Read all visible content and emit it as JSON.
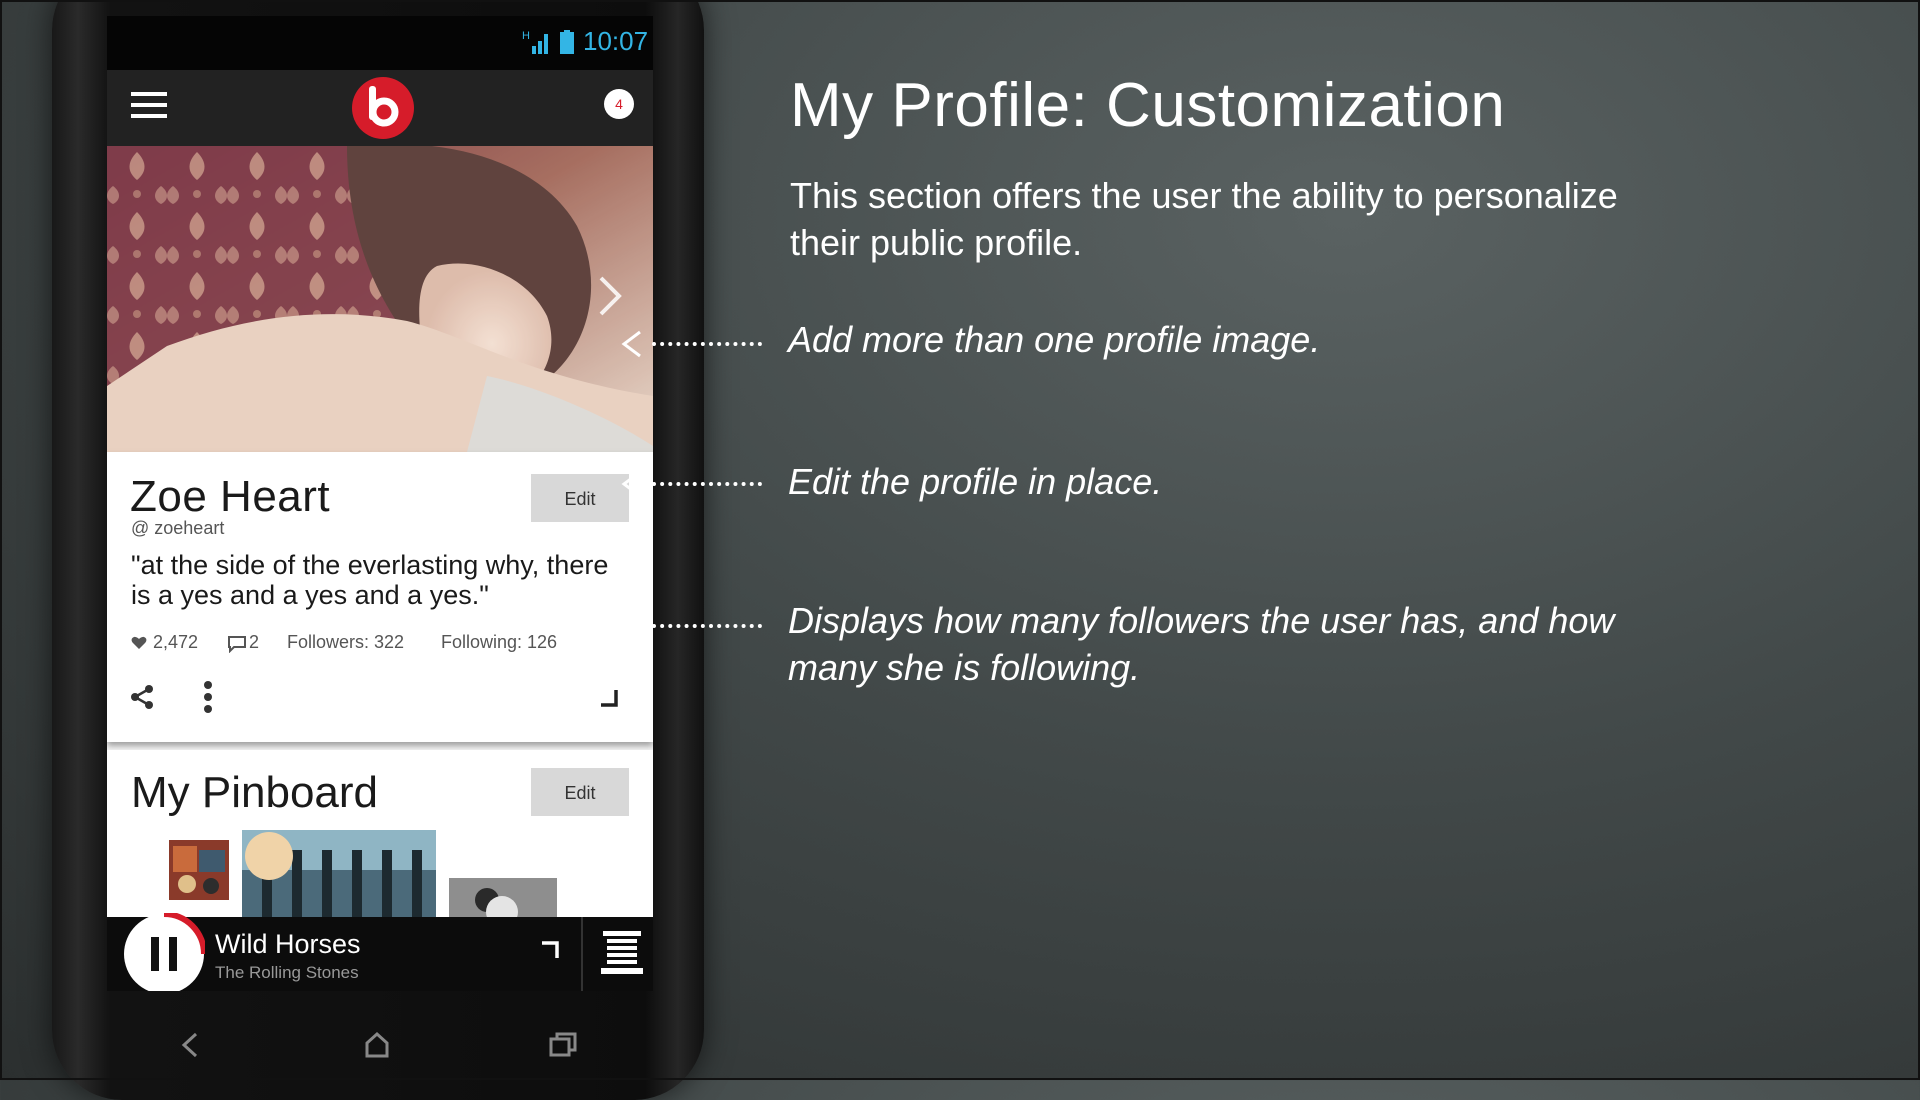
{
  "status_bar": {
    "time": "10:07",
    "network_label": "H"
  },
  "app_bar": {
    "notifications_count": "4"
  },
  "profile": {
    "name": "Zoe Heart",
    "handle": "@ zoeheart",
    "edit_label": "Edit",
    "quote": "\"at the side of the everlasting why, there is a yes and a yes and a yes.\"",
    "likes": "2,472",
    "comments": "2",
    "followers": "Followers: 322",
    "following": "Following: 126"
  },
  "pinboard": {
    "title": "My Pinboard",
    "edit_label": "Edit"
  },
  "player": {
    "track_title": "Wild Horses",
    "artist": "The Rolling Stones"
  },
  "slide": {
    "title": "My Profile: Customization",
    "intro": "This section offers the user the ability to personalize their public profile.",
    "callouts": [
      "Add more than one profile image.",
      "Edit the profile in place.",
      "Displays how many followers the user has, and how many she is following."
    ]
  },
  "colors": {
    "brand_red": "#d61c2a",
    "status_blue": "#33b5e5",
    "background": "#424949"
  }
}
